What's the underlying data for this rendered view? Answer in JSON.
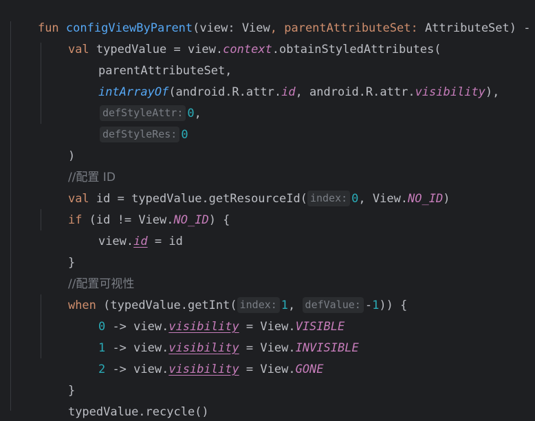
{
  "code": {
    "l1": {
      "fun": "fun",
      "name": "configViewByParent",
      "open": "(view: ",
      "type1": "View",
      "sep": ", parentAttributeSet: ",
      "type2": "AttributeSet",
      "close": ") -"
    },
    "l2": {
      "val": "val",
      "rest": " typedValue = view.",
      "context": "context",
      "call": ".obtainStyledAttributes("
    },
    "l3": {
      "text": "parentAttributeSet,"
    },
    "l4": {
      "func": "intArrayOf",
      "p1": "(android.R.attr.",
      "id": "id",
      "p2": ", android.R.attr.",
      "visibility": "visibility",
      "end": "),"
    },
    "l5": {
      "hint": "defStyleAttr:",
      "value": "0",
      "comma": ","
    },
    "l6": {
      "hint": "defStyleRes:",
      "value": "0"
    },
    "l7": {
      "text": ")"
    },
    "l8": {
      "comment": "//配置 ID"
    },
    "l9": {
      "val": "val",
      "rest": " id = typedValue.getResourceId(",
      "hint": "index:",
      "value": "0",
      "mid": ", View.",
      "noid": "NO_ID",
      "end": ")"
    },
    "l10": {
      "if": "if",
      "rest": " (id != View.",
      "noid": "NO_ID",
      "end": ") {"
    },
    "l11": {
      "pre": "view.",
      "id": "id",
      "rest": " = id"
    },
    "l12": {
      "text": "}"
    },
    "l13": {
      "comment": "//配置可视性"
    },
    "l14": {
      "when": "when",
      "rest": " (typedValue.getInt(",
      "hint1": "index:",
      "value1": "1",
      "comma": ",",
      "hint2": "defValue:",
      "minus": "-",
      "value2": "1",
      "end": ")) {"
    },
    "l15": {
      "num": "0",
      "arrow": " -> view.",
      "prop": "visibility",
      "assign": " = View.",
      "const": "VISIBLE"
    },
    "l16": {
      "num": "1",
      "arrow": " -> view.",
      "prop": "visibility",
      "assign": " = View.",
      "const": "INVISIBLE"
    },
    "l17": {
      "num": "2",
      "arrow": " -> view.",
      "prop": "visibility",
      "assign": " = View.",
      "const": "GONE"
    },
    "l18": {
      "text": "}"
    },
    "l19": {
      "text": "typedValue.recycle()"
    },
    "l20": {
      "text": "}"
    }
  },
  "colors": {
    "background": "#1e1f22",
    "keyword": "#cf8e6d",
    "function": "#56a8f5",
    "number": "#2aacb8",
    "comment": "#7a7e85",
    "property": "#c77dbb",
    "text": "#bcbec4",
    "hint_background": "#2b2d30"
  }
}
